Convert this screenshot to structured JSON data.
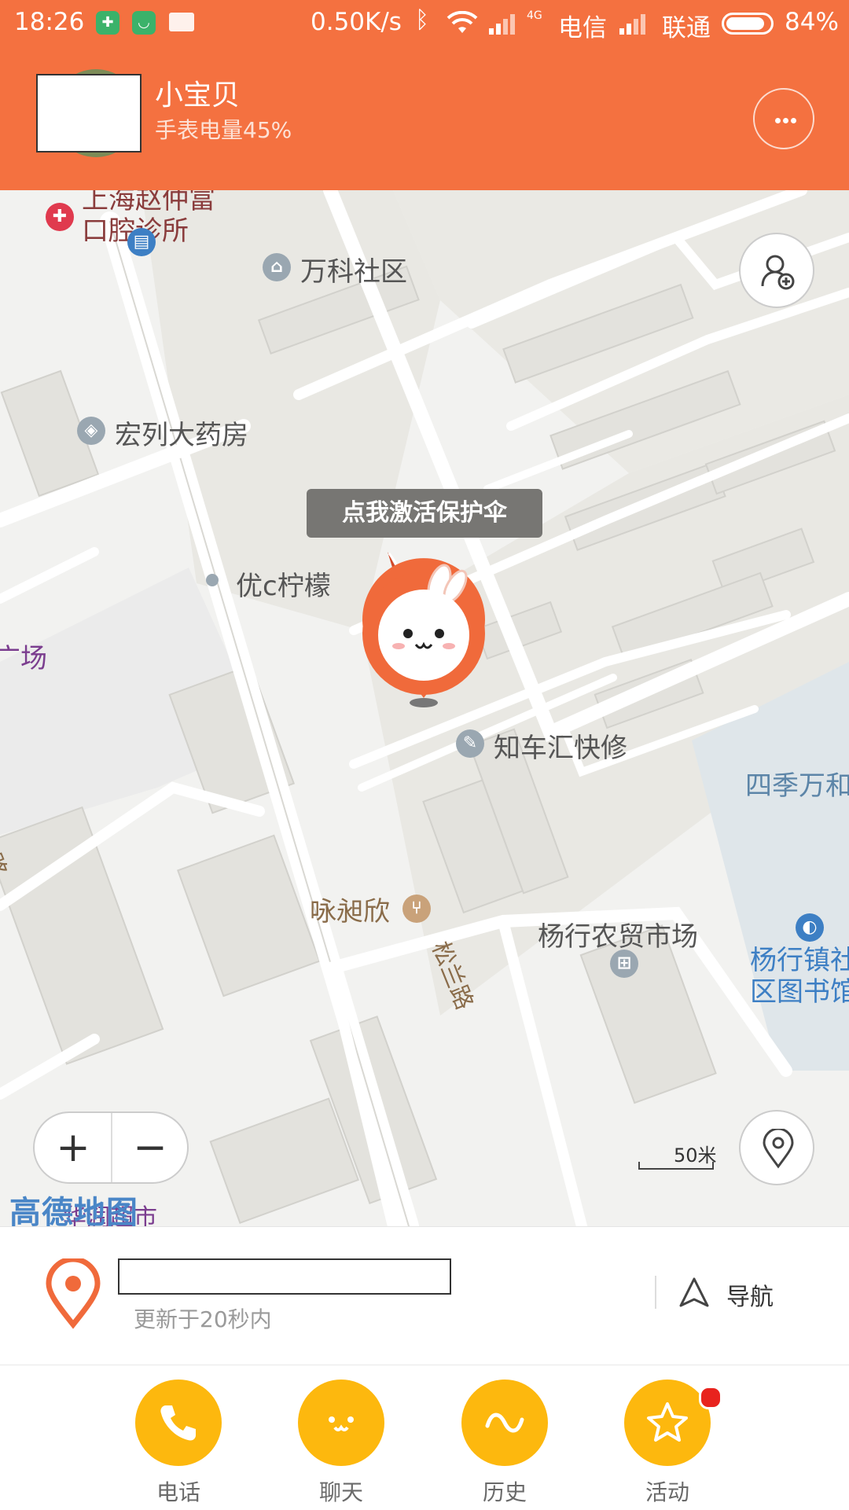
{
  "status_bar": {
    "time": "18:26",
    "net_speed": "0.50K/s",
    "carrier1": "电信",
    "carrier2": "联通",
    "battery": "84%",
    "network_type": "4G"
  },
  "header": {
    "name": "小宝贝",
    "watch_battery": "手表电量45%"
  },
  "map": {
    "pois": [
      {
        "label": "上海赵仲富\n口腔诊所",
        "icon": "clinic-icon"
      },
      {
        "label": "万科社区",
        "icon": "community-icon"
      },
      {
        "label": "宏列大药房",
        "icon": "pharmacy-icon"
      },
      {
        "label": "优c柠檬",
        "icon": "dot-icon"
      },
      {
        "label": "知车汇快修",
        "icon": "repair-icon"
      },
      {
        "label": "咏昶欣",
        "icon": "restaurant-icon"
      },
      {
        "label": "杨行农贸市场",
        "icon": "market-icon"
      },
      {
        "label": "四季万和",
        "icon": ""
      },
      {
        "label": "杨行镇社\n区图书馆",
        "icon": "library-icon"
      },
      {
        "label": "广场",
        "icon": ""
      },
      {
        "label": "华润超市",
        "icon": ""
      }
    ],
    "road_label": "松兰路",
    "road_label_left": "宗路",
    "tooltip": "点我激活保护伞",
    "zoom_in": "+",
    "zoom_out": "−",
    "logo": "高德地图",
    "scale": "50米"
  },
  "location": {
    "updated": "更新于20秒内",
    "nav_label": "导航"
  },
  "tabs": [
    {
      "label": "电话",
      "icon": "phone-icon"
    },
    {
      "label": "聊天",
      "icon": "chat-icon"
    },
    {
      "label": "历史",
      "icon": "history-icon"
    },
    {
      "label": "活动",
      "icon": "star-icon",
      "badge": true
    }
  ],
  "colors": {
    "primary": "#F47140",
    "tab_yellow": "#FDB80E",
    "badge_red": "#E8231E"
  }
}
